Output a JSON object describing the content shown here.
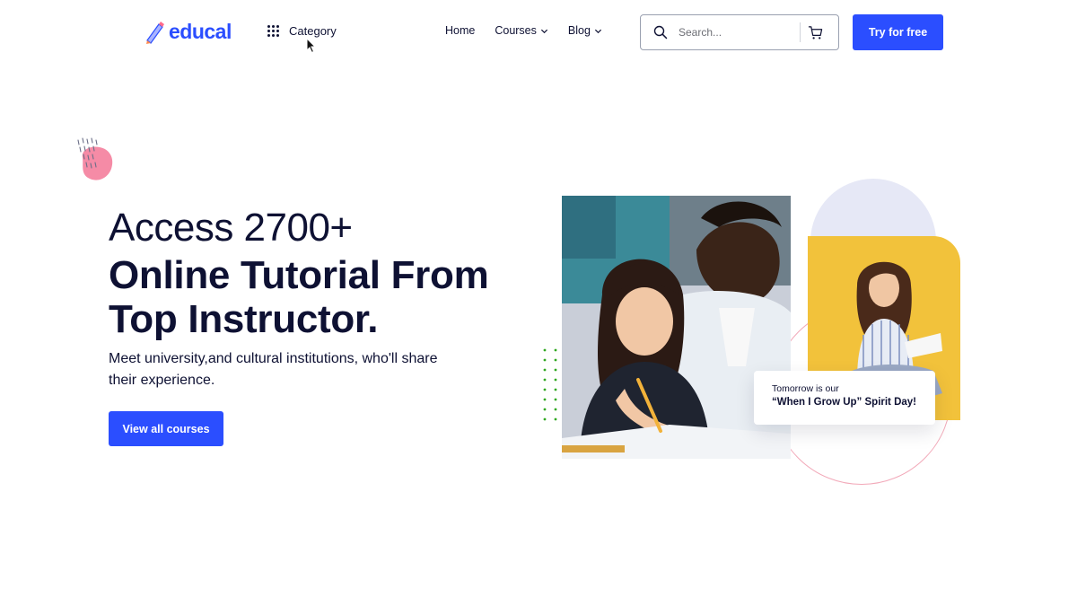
{
  "header": {
    "logo_text": "educal",
    "category_label": "Category",
    "nav": [
      {
        "label": "Home",
        "has_dropdown": false
      },
      {
        "label": "Courses",
        "has_dropdown": true
      },
      {
        "label": "Blog",
        "has_dropdown": true
      }
    ],
    "search": {
      "placeholder": "Search..."
    },
    "cta_label": "Try for free"
  },
  "hero": {
    "subtitle": "Access 2700+",
    "title": "Online Tutorial From Top Instructor.",
    "description": "Meet university,and cultural institutions, who'll share their experience.",
    "button_label": "View all courses"
  },
  "spirit_card": {
    "line1": "Tomorrow is our",
    "line2": "“When I Grow Up” Spirit Day!"
  },
  "colors": {
    "accent": "#2b4eff",
    "heading": "#0e1133",
    "side_photo_bg": "#f2c23b",
    "blob_pink": "#f58ba6",
    "dots_green": "#30a820"
  },
  "icons": [
    "logo-pencil-icon",
    "category-grid-icon",
    "chevron-down-icon",
    "search-icon",
    "cart-icon",
    "mouse-cursor-icon"
  ]
}
